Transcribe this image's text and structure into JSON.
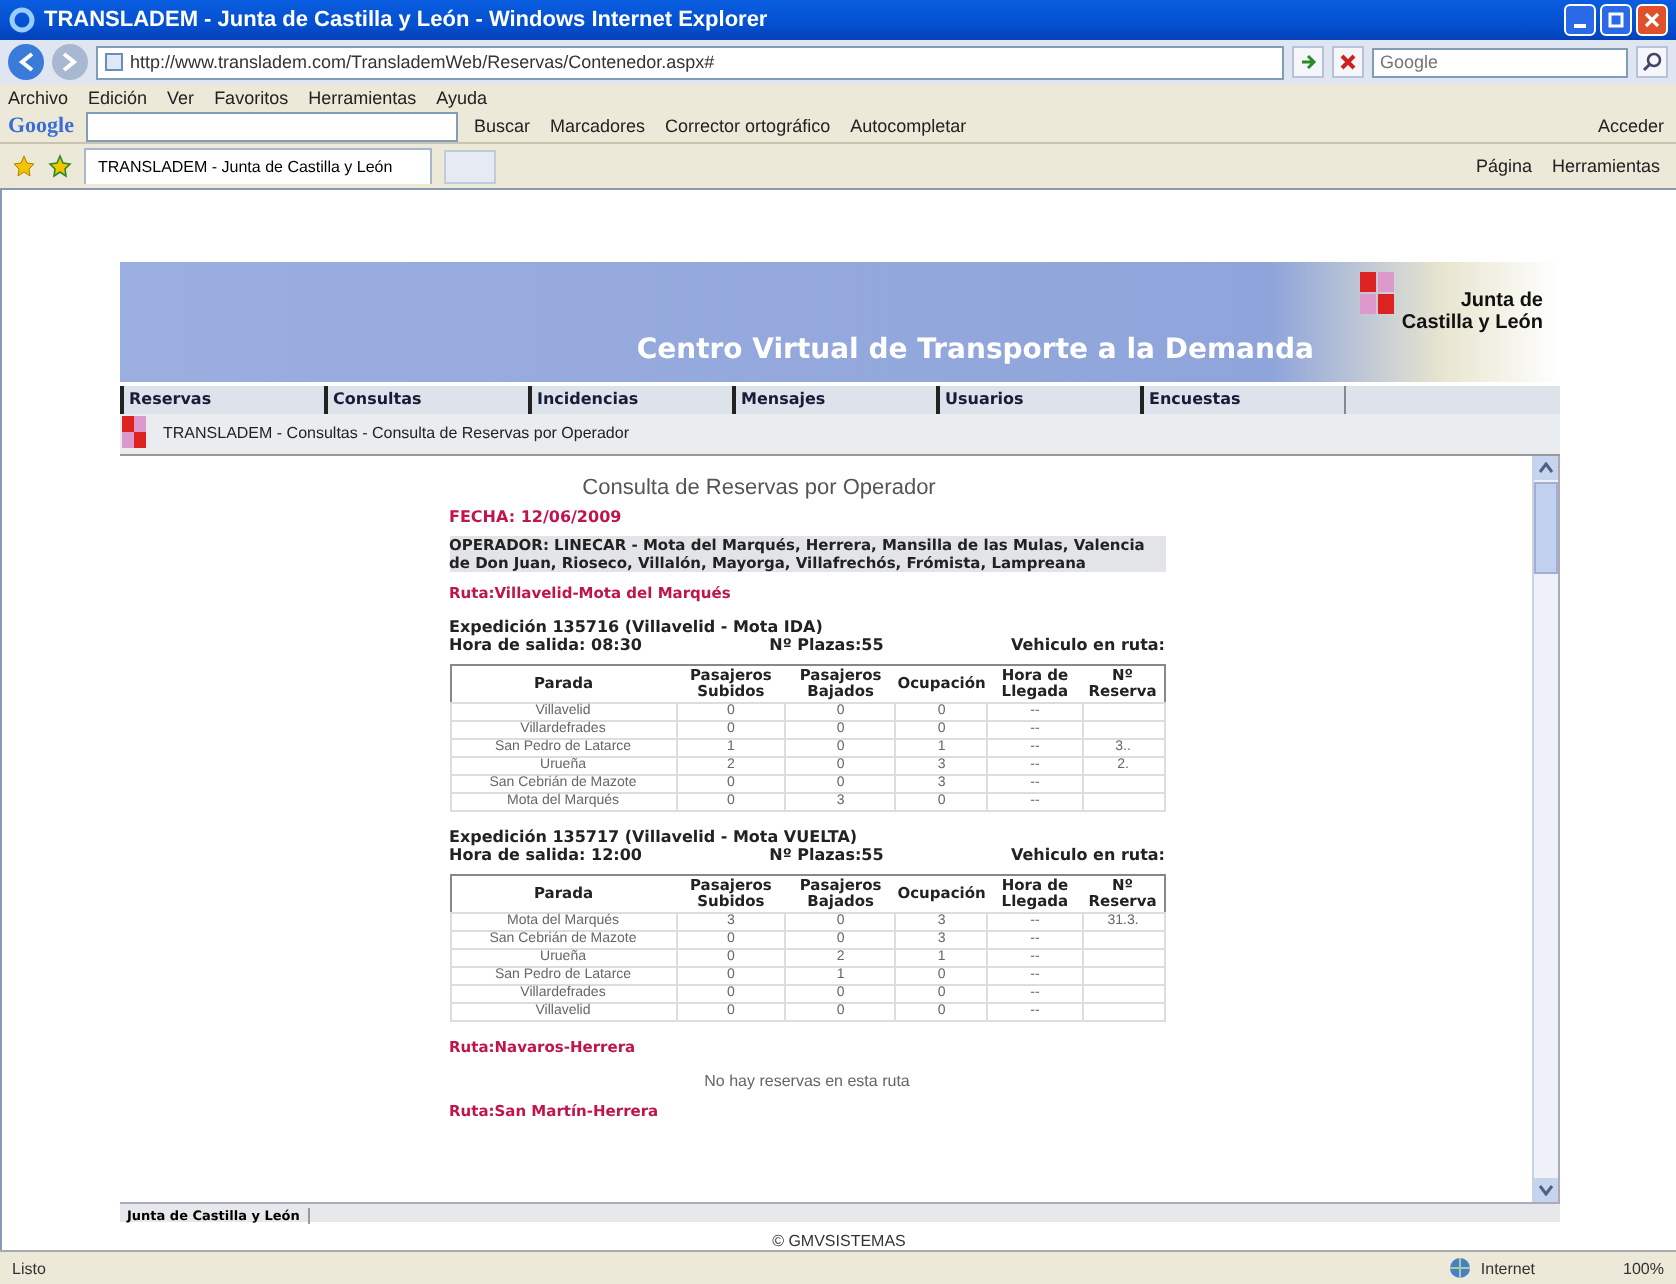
{
  "window": {
    "title": "TRANSLADEM - Junta de Castilla y León - Windows Internet Explorer"
  },
  "address_bar": {
    "url": "http://www.transladem.com/TranslademWeb/Reservas/Contenedor.aspx#"
  },
  "search_box": {
    "placeholder": "Google"
  },
  "menu": [
    "Archivo",
    "Edición",
    "Ver",
    "Favoritos",
    "Herramientas",
    "Ayuda"
  ],
  "google_toolbar": {
    "logo": "Google",
    "search": "Buscar",
    "bookmarks": "Marcadores",
    "spelling": "Corrector ortográfico",
    "autofill": "Autocompletar",
    "sign_in": "Acceder"
  },
  "tab": {
    "title": "TRANSLADEM - Junta de Castilla y León"
  },
  "command_bar": [
    "Página",
    "Herramientas"
  ],
  "page": {
    "banner_title": "Centro Virtual de Transporte a la Demanda",
    "logo_lines": [
      "Junta de",
      "Castilla y León"
    ],
    "nav": [
      "Reservas",
      "Consultas",
      "Incidencias",
      "Mensajes",
      "Usuarios",
      "Encuestas"
    ],
    "breadcrumb": "TRANSLADEM - Consultas - Consulta de Reservas por Operador",
    "heading": "Consulta de Reservas por Operador",
    "date": "FECHA: 12/06/2009",
    "operator": "OPERADOR: LINECAR - Mota del Marqués, Herrera, Mansilla de las Mulas, Valencia de Don Juan, Rioseco, Villalón, Mayorga, Villafrechós, Frómista, Lampreana",
    "routes": [
      {
        "name": "Ruta:Villavelid-Mota del Marqués",
        "expeditions": [
          {
            "title": "Expedición 135716  (Villavelid - Mota IDA)",
            "departure": "Hora de salida: 08:30",
            "seats": "Nº Plazas:55",
            "vehicle": "Vehiculo en ruta:",
            "columns": [
              "Parada",
              "Pasajeros Subidos",
              "Pasajeros Bajados",
              "Ocupación",
              "Hora de Llegada",
              "Nº Reserva"
            ],
            "rows": [
              [
                "Villavelid",
                "0",
                "0",
                "0",
                "--",
                ""
              ],
              [
                "Villardefrades",
                "0",
                "0",
                "0",
                "--",
                ""
              ],
              [
                "San Pedro de Latarce",
                "1",
                "0",
                "1",
                "--",
                "3.."
              ],
              [
                "Urueña",
                "2",
                "0",
                "3",
                "--",
                "2."
              ],
              [
                "San Cebrián de Mazote",
                "0",
                "0",
                "3",
                "--",
                ""
              ],
              [
                "Mota del Marqués",
                "0",
                "3",
                "0",
                "--",
                ""
              ]
            ]
          },
          {
            "title": "Expedición 135717  (Villavelid - Mota VUELTA)",
            "departure": "Hora de salida: 12:00",
            "seats": "Nº Plazas:55",
            "vehicle": "Vehiculo en ruta:",
            "columns": [
              "Parada",
              "Pasajeros Subidos",
              "Pasajeros Bajados",
              "Ocupación",
              "Hora de Llegada",
              "Nº Reserva"
            ],
            "rows": [
              [
                "Mota del Marqués",
                "3",
                "0",
                "3",
                "--",
                "31.3."
              ],
              [
                "San Cebrián de Mazote",
                "0",
                "0",
                "3",
                "--",
                ""
              ],
              [
                "Urueña",
                "0",
                "2",
                "1",
                "--",
                ""
              ],
              [
                "San Pedro de Latarce",
                "0",
                "1",
                "0",
                "--",
                ""
              ],
              [
                "Villardefrades",
                "0",
                "0",
                "0",
                "--",
                ""
              ],
              [
                "Villavelid",
                "0",
                "0",
                "0",
                "--",
                ""
              ]
            ]
          }
        ]
      },
      {
        "name": "Ruta:Navaros-Herrera",
        "empty_message": "No hay reservas en esta ruta"
      },
      {
        "name": "Ruta:San Martín-Herrera"
      }
    ],
    "footer": "Junta de Castilla y León",
    "copyright": "© GMVSISTEMAS"
  },
  "status_bar": {
    "text": "Listo",
    "zone": "Internet",
    "zoom": "100%"
  }
}
